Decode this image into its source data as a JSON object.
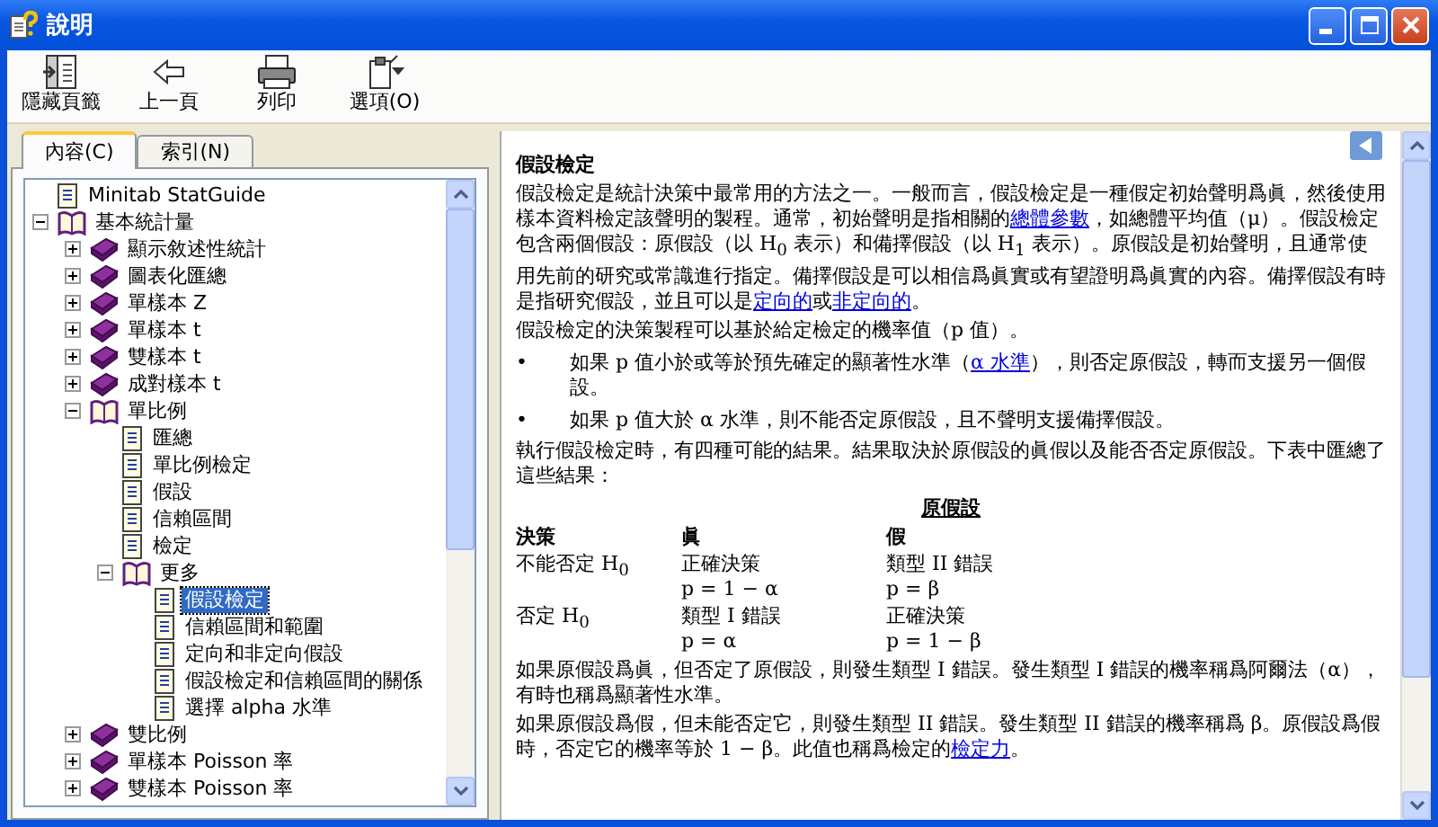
{
  "window": {
    "title": "說明"
  },
  "toolbar": [
    {
      "label": "隱藏頁籤",
      "kind": "hide"
    },
    {
      "label": "上一頁",
      "kind": "back"
    },
    {
      "label": "列印",
      "kind": "print"
    },
    {
      "label": "選項(O)",
      "kind": "options"
    }
  ],
  "tabs": [
    {
      "label": "內容(C)",
      "selected": true
    },
    {
      "label": "索引(N)",
      "selected": false
    }
  ],
  "tree": [
    {
      "label": "Minitab StatGuide",
      "kind": "page",
      "selected": false
    },
    {
      "label": "基本統計量",
      "kind": "book",
      "expanded": true,
      "selected": false,
      "children": [
        {
          "label": "顯示敘述性統計",
          "kind": "book",
          "expanded": false,
          "selected": false
        },
        {
          "label": "圖表化匯總",
          "kind": "book",
          "expanded": false,
          "selected": false
        },
        {
          "label": "單樣本 Z",
          "kind": "book",
          "expanded": false,
          "selected": false
        },
        {
          "label": "單樣本 t",
          "kind": "book",
          "expanded": false,
          "selected": false
        },
        {
          "label": "雙樣本 t",
          "kind": "book",
          "expanded": false,
          "selected": false
        },
        {
          "label": "成對樣本 t",
          "kind": "book",
          "expanded": false,
          "selected": false
        },
        {
          "label": "單比例",
          "kind": "book",
          "expanded": true,
          "selected": false,
          "children": [
            {
              "label": "匯總",
              "kind": "page",
              "selected": false
            },
            {
              "label": "單比例檢定",
              "kind": "page",
              "selected": false
            },
            {
              "label": "假設",
              "kind": "page",
              "selected": false
            },
            {
              "label": "信賴區間",
              "kind": "page",
              "selected": false
            },
            {
              "label": "檢定",
              "kind": "page",
              "selected": false
            },
            {
              "label": "更多",
              "kind": "book",
              "expanded": true,
              "selected": false,
              "children": [
                {
                  "label": "假設檢定",
                  "kind": "page",
                  "selected": true
                },
                {
                  "label": "信賴區間和範圍",
                  "kind": "page",
                  "selected": false
                },
                {
                  "label": "定向和非定向假設",
                  "kind": "page",
                  "selected": false
                },
                {
                  "label": "假設檢定和信賴區間的關係",
                  "kind": "page",
                  "selected": false
                },
                {
                  "label": "選擇 alpha 水準",
                  "kind": "page",
                  "selected": false
                }
              ]
            }
          ]
        },
        {
          "label": "雙比例",
          "kind": "book",
          "expanded": false,
          "selected": false
        },
        {
          "label": "單樣本 Poisson 率",
          "kind": "book",
          "expanded": false,
          "selected": false
        },
        {
          "label": "雙樣本 Poisson 率",
          "kind": "book",
          "expanded": false,
          "selected": false
        }
      ]
    }
  ],
  "article": {
    "title": "假設檢定",
    "blocks": [
      {
        "kind": "para",
        "segments": [
          {
            "t": "假設檢定是統計決策中最常用的方法之一。一般而言，假設檢定是一種假定初始聲明爲眞，然後使用樣本資料檢定該聲明的製程。通常，初始聲明是指相關的",
            "link": false
          },
          {
            "t": "總體參數",
            "link": true
          },
          {
            "t": "，如總體平均值（μ）。假設檢定包含兩個假設：原假設（以 H$_{0}$ 表示）和備擇假設（以 H$_{1}$ 表示）。原假設是初始聲明，且通常使用先前的研究或常識進行指定。備擇假設是可以相信爲眞實或有望證明爲眞實的內容。備擇假設有時是指研究假設，並且可以是",
            "link": false
          },
          {
            "t": "定向的",
            "link": true
          },
          {
            "t": "或",
            "link": false
          },
          {
            "t": "非定向的",
            "link": true
          },
          {
            "t": "。",
            "link": false
          }
        ]
      },
      {
        "kind": "para",
        "segments": [
          {
            "t": "假設檢定的決策製程可以基於給定檢定的機率值（p 值）。",
            "link": false
          }
        ]
      },
      {
        "kind": "bullet",
        "bullet": "•",
        "segments": [
          {
            "t": "如果 p 值小於或等於預先確定的顯著性水準（",
            "link": false
          },
          {
            "t": "α 水準",
            "link": true
          },
          {
            "t": "），則否定原假設，轉而支援另一個假設。",
            "link": false
          }
        ]
      },
      {
        "kind": "bullet",
        "bullet": "•",
        "segments": [
          {
            "t": "如果 p 值大於 α 水準，則不能否定原假設，且不聲明支援備擇假設。",
            "link": false
          }
        ]
      },
      {
        "kind": "para",
        "segments": [
          {
            "t": "執行假設檢定時，有四種可能的結果。結果取決於原假設的眞假以及能否否定原假設。下表中匯總了這些結果：",
            "link": false
          }
        ]
      },
      {
        "kind": "table",
        "title": "原假設",
        "columns": [
          "決策",
          "眞",
          "假"
        ],
        "rows": [
          {
            "cells": [
              [
                "不能否定 H$_{0}$"
              ],
              [
                "正確決策",
                "p = 1 − α"
              ],
              [
                "類型 II 錯誤",
                "p = β"
              ]
            ]
          },
          {
            "cells": [
              [
                "否定 H$_{0}$"
              ],
              [
                "類型 I 錯誤",
                "p = α"
              ],
              [
                "正確決策",
                "p = 1 − β"
              ]
            ]
          }
        ]
      },
      {
        "kind": "para",
        "segments": [
          {
            "t": "如果原假設爲眞，但否定了原假設，則發生類型 I 錯誤。發生類型 I 錯誤的機率稱爲阿爾法（α），有時也稱爲顯著性水準。",
            "link": false
          }
        ]
      },
      {
        "kind": "para",
        "segments": [
          {
            "t": "如果原假設爲假，但未能否定它，則發生類型 II 錯誤。發生類型 II 錯誤的機率稱爲 β。原假設爲假時，否定它的機率等於 1 − β。此值也稱爲檢定的",
            "link": false
          },
          {
            "t": "檢定力",
            "link": true
          },
          {
            "t": "。",
            "link": false
          }
        ]
      }
    ]
  }
}
